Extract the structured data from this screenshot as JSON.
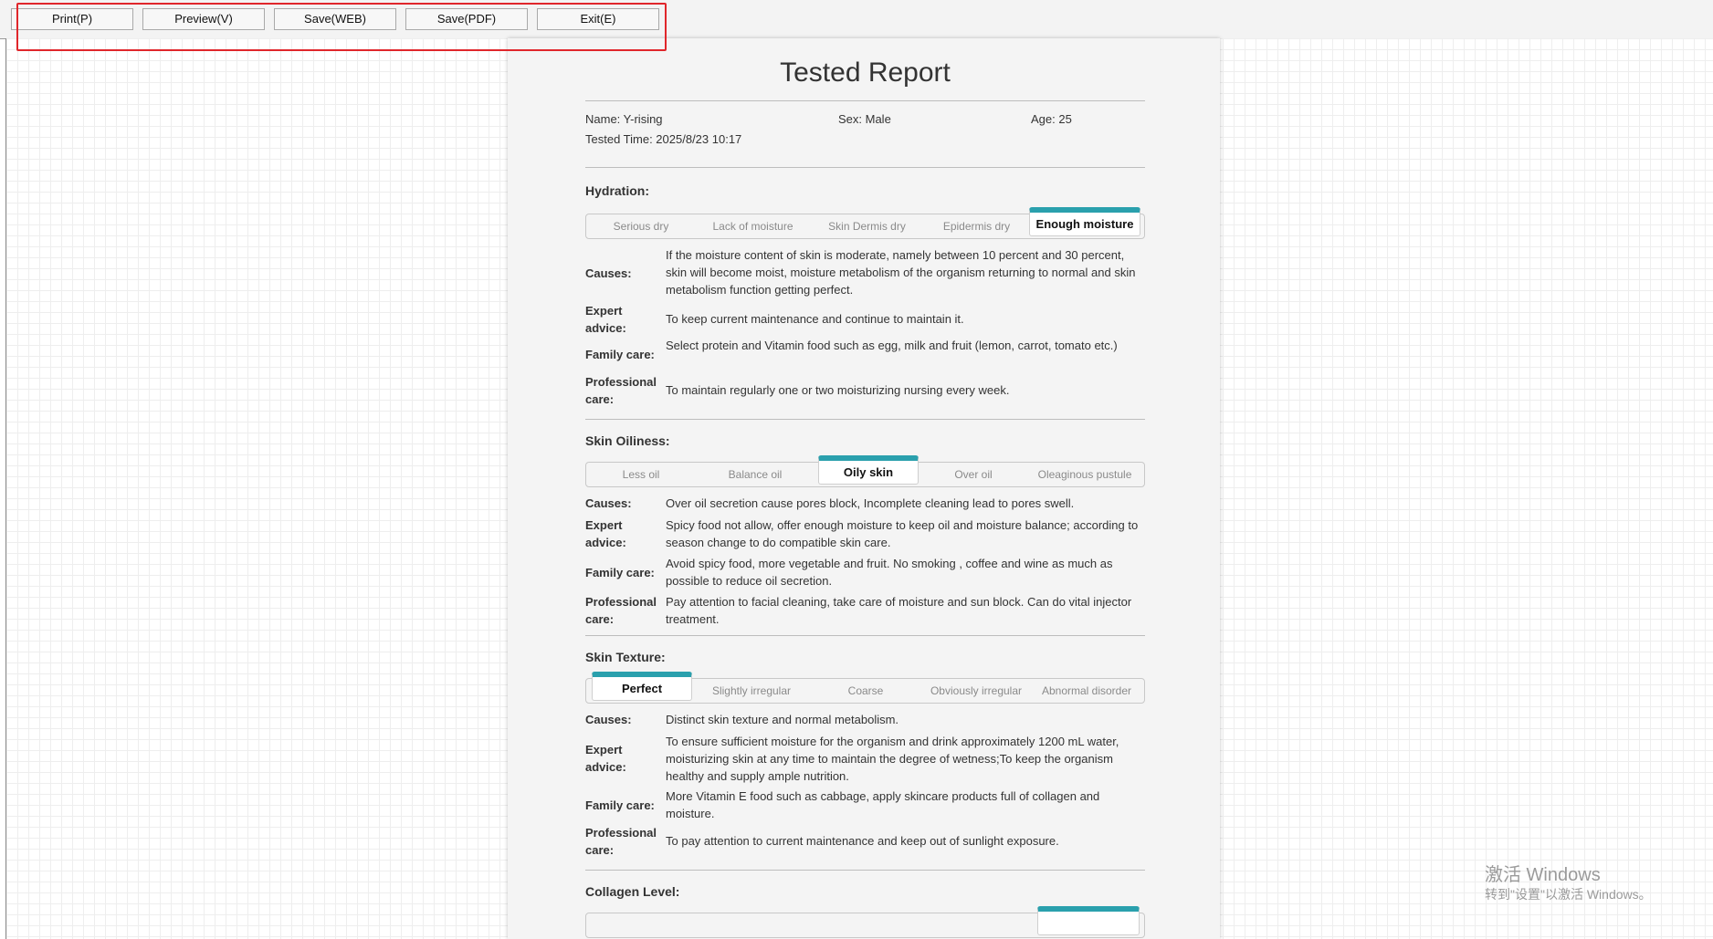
{
  "toolbar": {
    "buttons": [
      {
        "label": "Print(P)"
      },
      {
        "label": "Preview(V)"
      },
      {
        "label": "Save(WEB)"
      },
      {
        "label": "Save(PDF)"
      },
      {
        "label": "Exit(E)"
      }
    ],
    "highlight_color": "#e0262b"
  },
  "report": {
    "title": "Tested Report",
    "name": "Name: Y-rising",
    "sex": "Sex: Male",
    "age": "Age: 25",
    "tested_time": "Tested Time: 2025/8/23 10:17",
    "accent_color": "#2aa0ad",
    "labels": {
      "causes": "Causes:",
      "expert_1": "Expert",
      "expert_2": "advice:",
      "family": "Family care:",
      "professional_1": "Professional",
      "professional_2": "care:"
    },
    "hydration": {
      "title": "Hydration:",
      "tabs": [
        "Serious dry",
        "Lack of moisture",
        "Skin Dermis dry",
        "Epidermis dry",
        "Enough moisture"
      ],
      "selected": "Enough moisture",
      "causes": "If the moisture content of skin is moderate, namely between 10 percent and 30 percent, skin will become moist, moisture metabolism of the organism returning to normal and skin metabolism function getting perfect.",
      "expert": "To keep current maintenance and continue to maintain it.",
      "family": "Select protein and Vitamin food such as egg, milk and fruit (lemon, carrot, tomato etc.)",
      "professional": "To maintain regularly one or two moisturizing nursing every week."
    },
    "oiliness": {
      "title": "Skin Oiliness:",
      "tabs": [
        "Less oil",
        "Balance oil",
        "Oily skin",
        "Over oil",
        "Oleaginous pustule"
      ],
      "selected": "Oily skin",
      "causes": "Over oil secretion cause pores block, Incomplete cleaning lead to pores swell.",
      "expert": "Spicy food not allow, offer enough moisture to keep oil and moisture balance; according to season change to do compatible skin care.",
      "family": "Avoid spicy food, more vegetable and fruit. No smoking , coffee and wine as much as possible to reduce oil secretion.",
      "professional": "Pay attention to facial cleaning, take care of moisture and sun block. Can do vital injector treatment."
    },
    "texture": {
      "title": "Skin Texture:",
      "tabs": [
        "Perfect",
        "Slightly irregular",
        "Coarse",
        "Obviously irregular",
        "Abnormal disorder"
      ],
      "selected": "Perfect",
      "causes": "Distinct skin texture and normal metabolism.",
      "expert": "To ensure sufficient moisture for the organism and drink approximately 1200 mL water, moisturizing skin at any time to maintain the degree of wetness;To keep the organism healthy and supply ample nutrition.",
      "family": "More Vitamin E food such as cabbage, apply skincare products full of collagen and moisture.",
      "professional": "To pay attention to current maintenance and keep out of sunlight exposure."
    },
    "collagen": {
      "title": "Collagen Level:"
    }
  },
  "watermark": {
    "line1": "激活 Windows",
    "line2": "转到\"设置\"以激活 Windows。"
  }
}
